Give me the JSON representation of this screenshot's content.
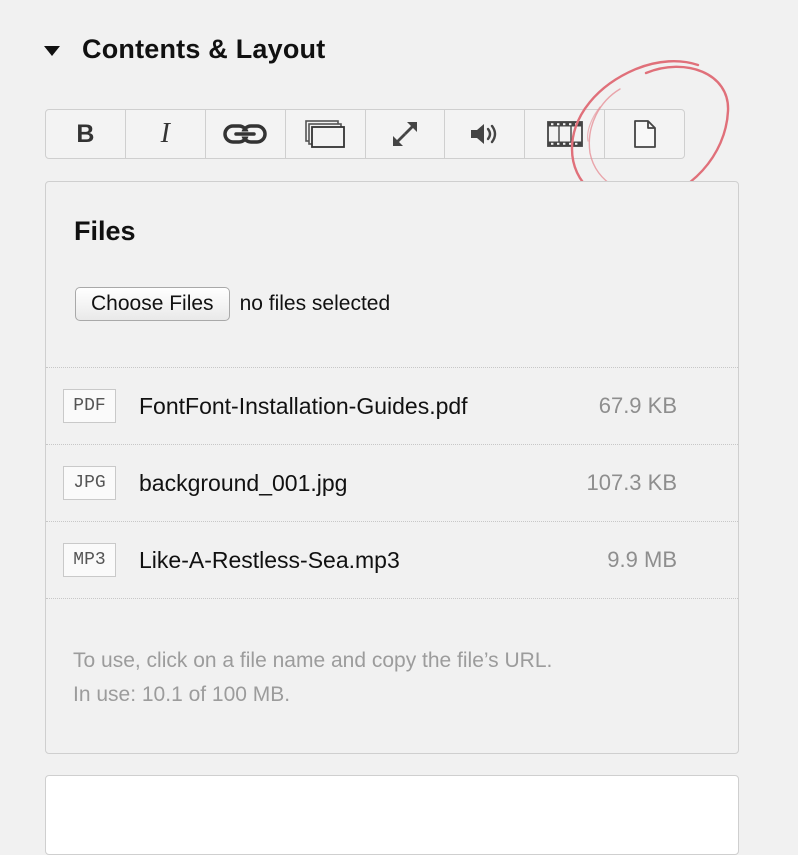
{
  "section": {
    "title": "Contents & Layout",
    "expanded": true,
    "toggle_icon": "triangle-down-icon"
  },
  "toolbar": {
    "buttons": [
      {
        "name": "bold",
        "label": "B",
        "icon": "bold-icon"
      },
      {
        "name": "italic",
        "label": "I",
        "icon": "italic-icon"
      },
      {
        "name": "link",
        "icon": "link-icon"
      },
      {
        "name": "gallery",
        "icon": "stacked-images-icon"
      },
      {
        "name": "fullscreen",
        "icon": "expand-arrows-icon"
      },
      {
        "name": "audio",
        "icon": "speaker-icon"
      },
      {
        "name": "video",
        "icon": "film-strip-icon"
      },
      {
        "name": "file",
        "icon": "document-icon"
      }
    ]
  },
  "annotation": {
    "shape": "hand-drawn-circle",
    "color": "#e0707a",
    "target": "file"
  },
  "files_panel": {
    "title": "Files",
    "choose_button_label": "Choose Files",
    "no_files_text": "no files selected",
    "files": [
      {
        "type": "PDF",
        "name": "FontFont-Installation-Guides.pdf",
        "size": "67.9 KB"
      },
      {
        "type": "JPG",
        "name": "background_001.jpg",
        "size": "107.3 KB"
      },
      {
        "type": "MP3",
        "name": "Like-A-Restless-Sea.mp3",
        "size": "9.9 MB"
      }
    ],
    "help_line_1": "To use, click on a file name and copy the file’s URL.",
    "help_line_2": "In use: 10.1 of 100 MB."
  },
  "colors": {
    "background": "#f1f1f1",
    "border": "#cfcfcf",
    "muted_text": "#9c9c9c",
    "annotation": "#e0707a"
  }
}
